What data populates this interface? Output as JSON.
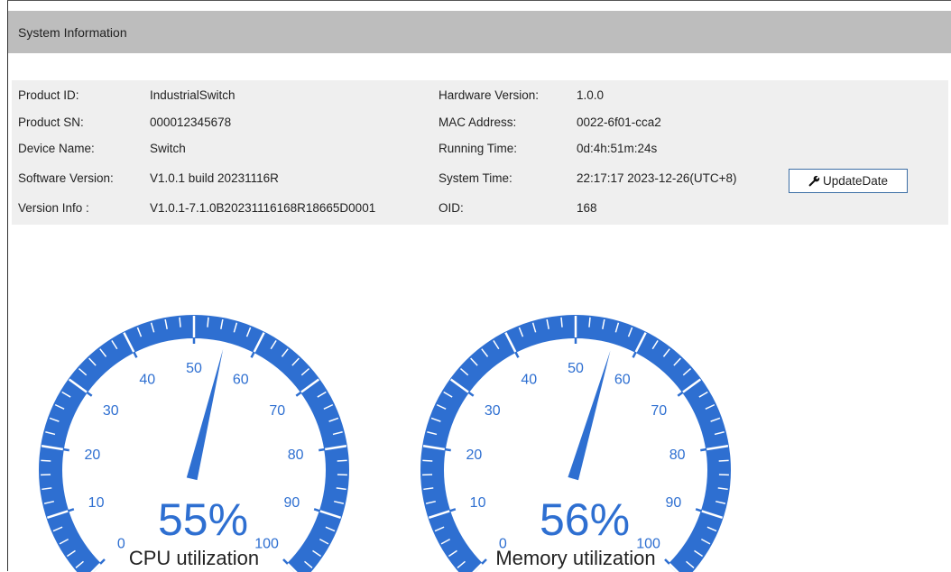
{
  "panel": {
    "title": "System Information"
  },
  "info": {
    "rows": [
      {
        "label1": "Product ID:",
        "value1": "IndustrialSwitch",
        "label2": "Hardware Version:",
        "value2": "1.0.0"
      },
      {
        "label1": "Product SN:",
        "value1": "000012345678",
        "label2": "MAC Address:",
        "value2": "0022-6f01-cca2"
      },
      {
        "label1": "Device Name:",
        "value1": "Switch",
        "label2": "Running Time:",
        "value2": "0d:4h:51m:24s"
      },
      {
        "label1": "Software Version:",
        "value1": "V1.0.1 build 20231116R",
        "label2": "System Time:",
        "value2": "22:17:17 2023-12-26(UTC+8)"
      },
      {
        "label1": "Version Info :",
        "value1": "V1.0.1-7.1.0B20231116168R18665D0001",
        "label2": "OID:",
        "value2": "168"
      }
    ],
    "update_button": "UpdateDate"
  },
  "gauges": [
    {
      "label": "CPU utilization",
      "value": 55,
      "value_text": "55%",
      "min": 0,
      "max": 100,
      "ticks": [
        "0",
        "10",
        "20",
        "30",
        "40",
        "50",
        "60",
        "70",
        "80",
        "90",
        "100"
      ]
    },
    {
      "label": "Memory utilization",
      "value": 56,
      "value_text": "56%",
      "min": 0,
      "max": 100,
      "ticks": [
        "0",
        "10",
        "20",
        "30",
        "40",
        "50",
        "60",
        "70",
        "80",
        "90",
        "100"
      ]
    }
  ],
  "colors": {
    "gauge_blue": "#2e6fd1",
    "header_gray": "#bdbdbd",
    "info_bg": "#efefef"
  },
  "icons": {
    "update_button_icon": "wrench-icon"
  }
}
